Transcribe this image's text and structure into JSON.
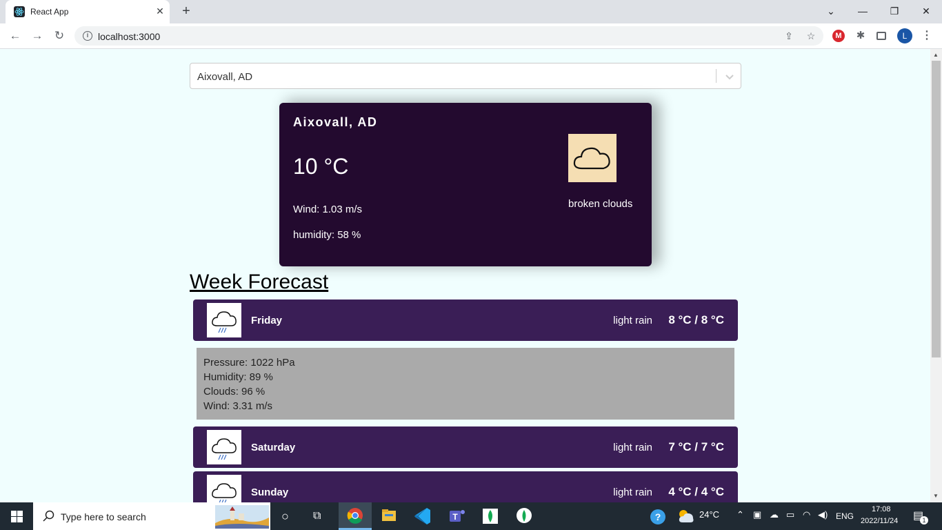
{
  "browser": {
    "tab_title": "React App",
    "url": "localhost:3000",
    "new_tab_symbol": "+",
    "close_symbol": "✕",
    "avatar_letter": "L",
    "mega_letter": "M"
  },
  "search": {
    "selected_city": "Aixovall, AD"
  },
  "current": {
    "city": "Aixovall, AD",
    "temperature": "10 °C",
    "wind": "Wind: 1.03 m/s",
    "humidity": "humidity: 58 %",
    "description": "broken clouds",
    "icon": "cloud-icon"
  },
  "forecast": {
    "title": "Week Forecast",
    "days": [
      {
        "name": "Friday",
        "description": "light rain",
        "temps": "8 °C / 8 °C",
        "icon": "rain-cloud-icon"
      },
      {
        "name": "Saturday",
        "description": "light rain",
        "temps": "7 °C / 7 °C",
        "icon": "rain-cloud-icon"
      },
      {
        "name": "Sunday",
        "description": "light rain",
        "temps": "4 °C / 4 °C",
        "icon": "rain-cloud-icon"
      }
    ],
    "details": {
      "pressure": "Pressure: 1022 hPa",
      "humidity": "Humidity: 89 %",
      "clouds": "Clouds: 96 %",
      "wind": "Wind: 3.31 m/s"
    }
  },
  "taskbar": {
    "search_placeholder": "Type here to search",
    "weather_temp": "24°C",
    "language": "ENG",
    "time": "17:08",
    "date": "2022/11/24",
    "notification_count": "1"
  },
  "colors": {
    "page_bg": "#f0fefe",
    "card_bg": "#230a2f",
    "day_row_bg": "#3a1e56",
    "details_bg": "#aaaaaa",
    "icon_bg": "#f5deb3"
  }
}
